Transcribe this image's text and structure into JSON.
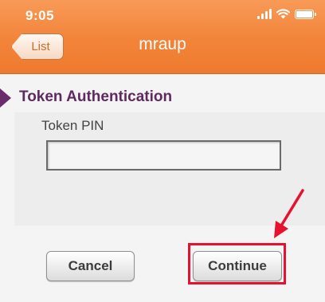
{
  "status_bar": {
    "time": "9:05"
  },
  "nav": {
    "back_label": "List",
    "title": "mraup"
  },
  "section": {
    "title": "Token Authentication"
  },
  "form": {
    "pin_label": "Token PIN",
    "pin_value": ""
  },
  "buttons": {
    "cancel": "Cancel",
    "continue": "Continue"
  },
  "colors": {
    "header": "#f2843a",
    "section_title": "#5e2a60",
    "highlight": "#e8102f"
  },
  "icons": [
    "signal-icon",
    "wifi-icon",
    "battery-icon",
    "back-arrow-icon",
    "section-arrow-icon",
    "pointer-arrow-icon"
  ]
}
